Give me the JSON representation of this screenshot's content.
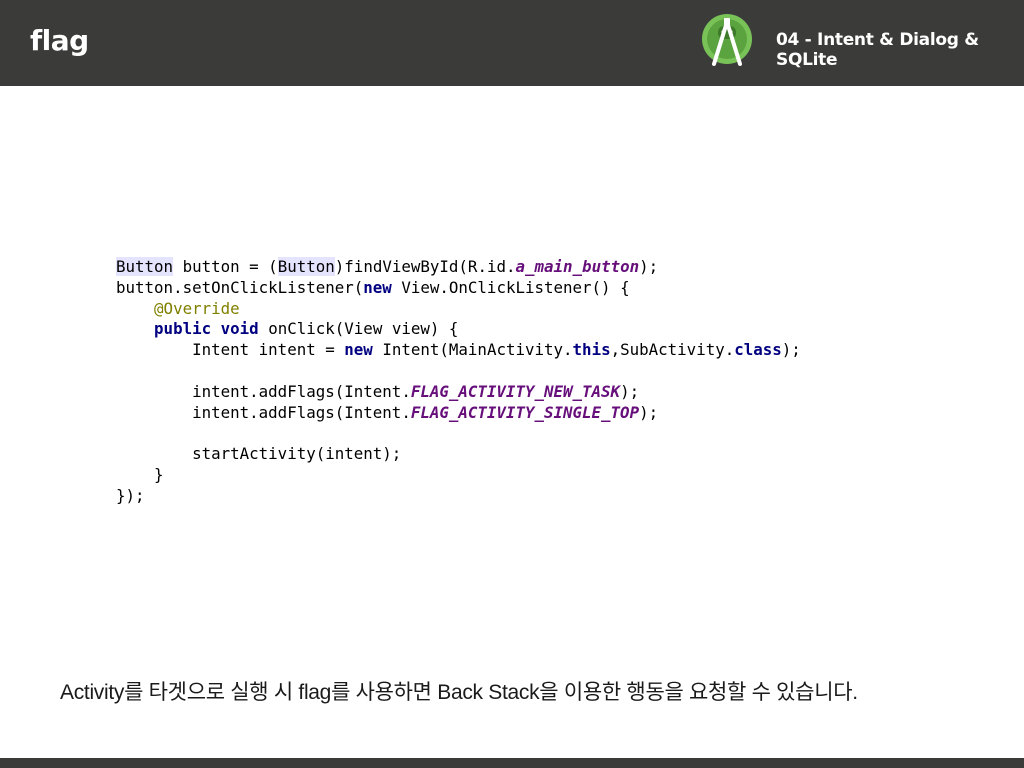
{
  "header": {
    "title": "flag",
    "subtitle": "04 - Intent & Dialog & SQLite",
    "logo_icon": "android-studio-icon",
    "bg_color": "#3b3b3a"
  },
  "code": {
    "lines": [
      [
        {
          "t": "Button",
          "c": "hl"
        },
        {
          "t": " button = ("
        },
        {
          "t": "Button",
          "c": "hl"
        },
        {
          "t": ")findViewById(R.id."
        },
        {
          "t": "a_main_button",
          "c": "fld"
        },
        {
          "t": ");"
        }
      ],
      [
        {
          "t": "button.setOnClickListener("
        },
        {
          "t": "new",
          "c": "kw"
        },
        {
          "t": " View.OnClickListener() {"
        }
      ],
      [
        {
          "t": "    "
        },
        {
          "t": "@Override",
          "c": "ann"
        }
      ],
      [
        {
          "t": "    "
        },
        {
          "t": "public",
          "c": "kw"
        },
        {
          "t": " "
        },
        {
          "t": "void",
          "c": "kw"
        },
        {
          "t": " onClick(View view) {"
        }
      ],
      [
        {
          "t": "        Intent intent = "
        },
        {
          "t": "new",
          "c": "kw"
        },
        {
          "t": " Intent(MainActivity."
        },
        {
          "t": "this",
          "c": "kw"
        },
        {
          "t": ",SubActivity."
        },
        {
          "t": "class",
          "c": "kw"
        },
        {
          "t": ");"
        }
      ],
      [],
      [
        {
          "t": "        intent.addFlags(Intent."
        },
        {
          "t": "FLAG_ACTIVITY_NEW_TASK",
          "c": "fld"
        },
        {
          "t": ");"
        }
      ],
      [
        {
          "t": "        intent.addFlags(Intent."
        },
        {
          "t": "FLAG_ACTIVITY_SINGLE_TOP",
          "c": "fld"
        },
        {
          "t": ");"
        }
      ],
      [],
      [
        {
          "t": "        startActivity(intent);"
        }
      ],
      [
        {
          "t": "    }"
        }
      ],
      [
        {
          "t": "});"
        }
      ]
    ]
  },
  "caption": "Activity를 타겟으로 실행 시 flag를 사용하면 Back Stack을 이용한 행동을 요청할 수 있습니다."
}
